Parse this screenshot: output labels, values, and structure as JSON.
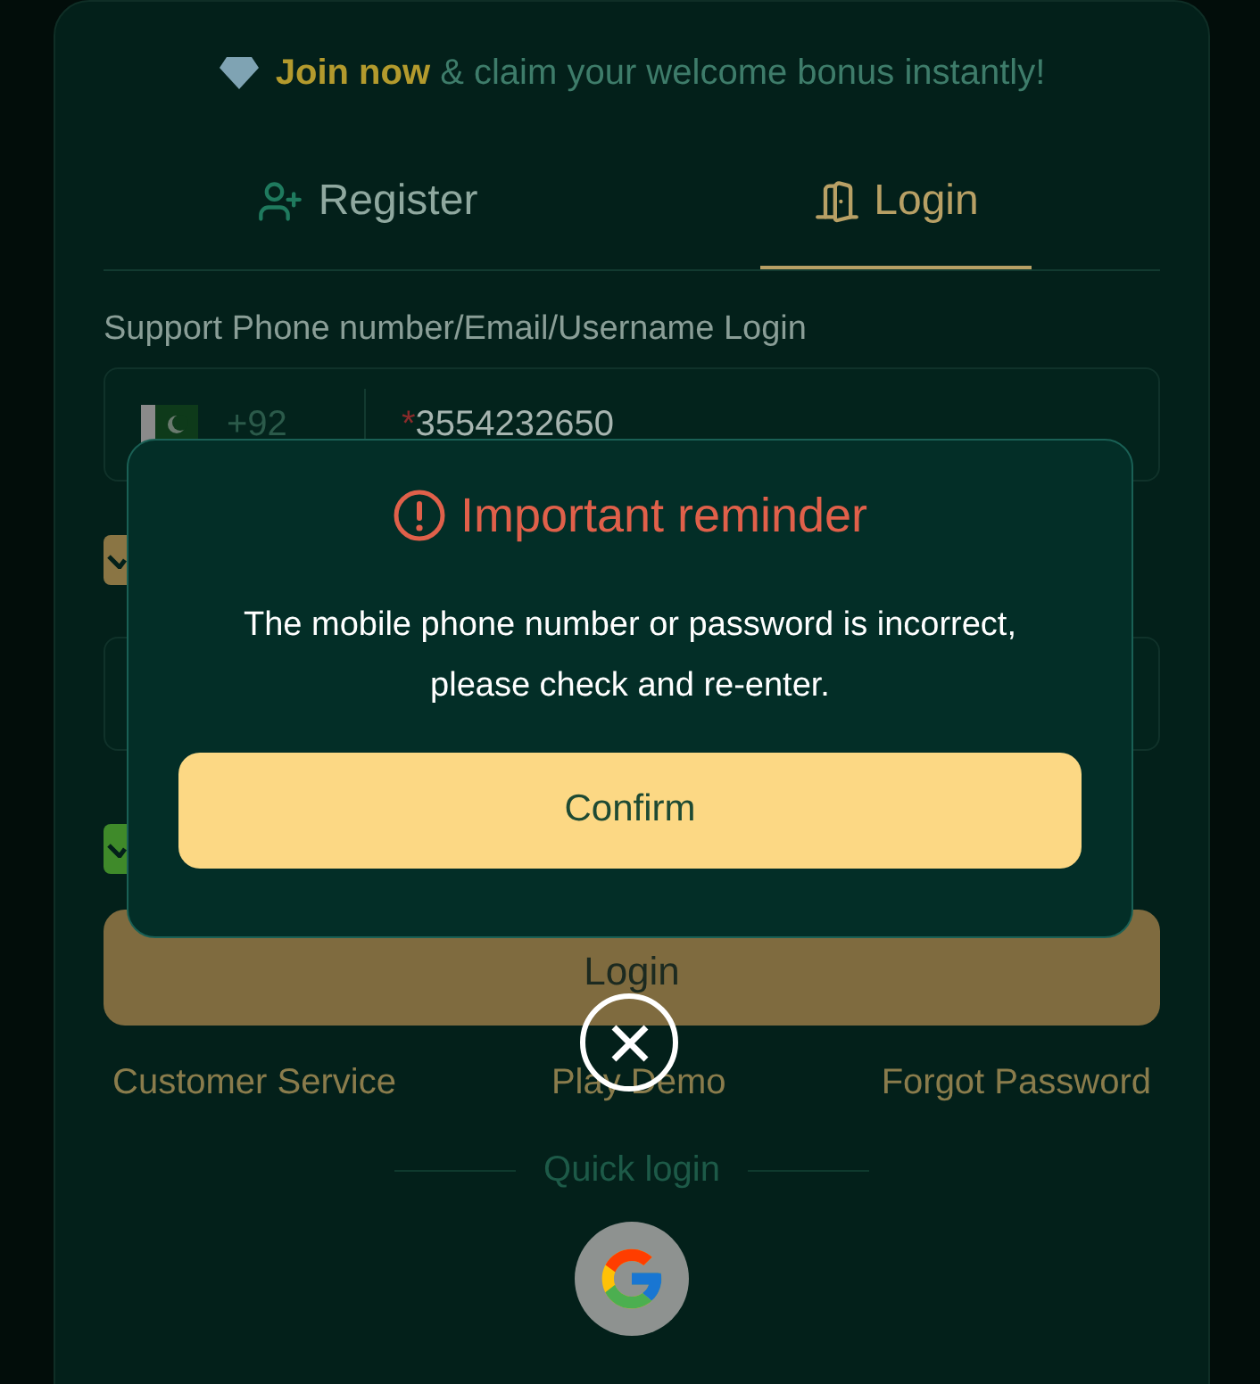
{
  "banner": {
    "highlight": "Join now",
    "text": "& claim your welcome bonus instantly!"
  },
  "tabs": [
    {
      "kind": "register",
      "label": "Register",
      "selected": false
    },
    {
      "kind": "login",
      "label": "Login",
      "selected": true
    }
  ],
  "login_hint": "Support Phone number/Email/Username Login",
  "phone_field": {
    "country_code": "+92",
    "required_mark": "*",
    "value": "3554232650"
  },
  "checkboxes": [
    {
      "checked": true,
      "color": "#8a7544"
    },
    {
      "checked": true,
      "color": "#3f8a2a"
    }
  ],
  "login_button": "Login",
  "links": [
    "Customer Service",
    "Play Demo",
    "Forgot Password"
  ],
  "quick_login": "Quick login",
  "dialog": {
    "title": "Important reminder",
    "message": "The mobile phone number or password is incorrect, please check and re-enter.",
    "confirm": "Confirm"
  }
}
